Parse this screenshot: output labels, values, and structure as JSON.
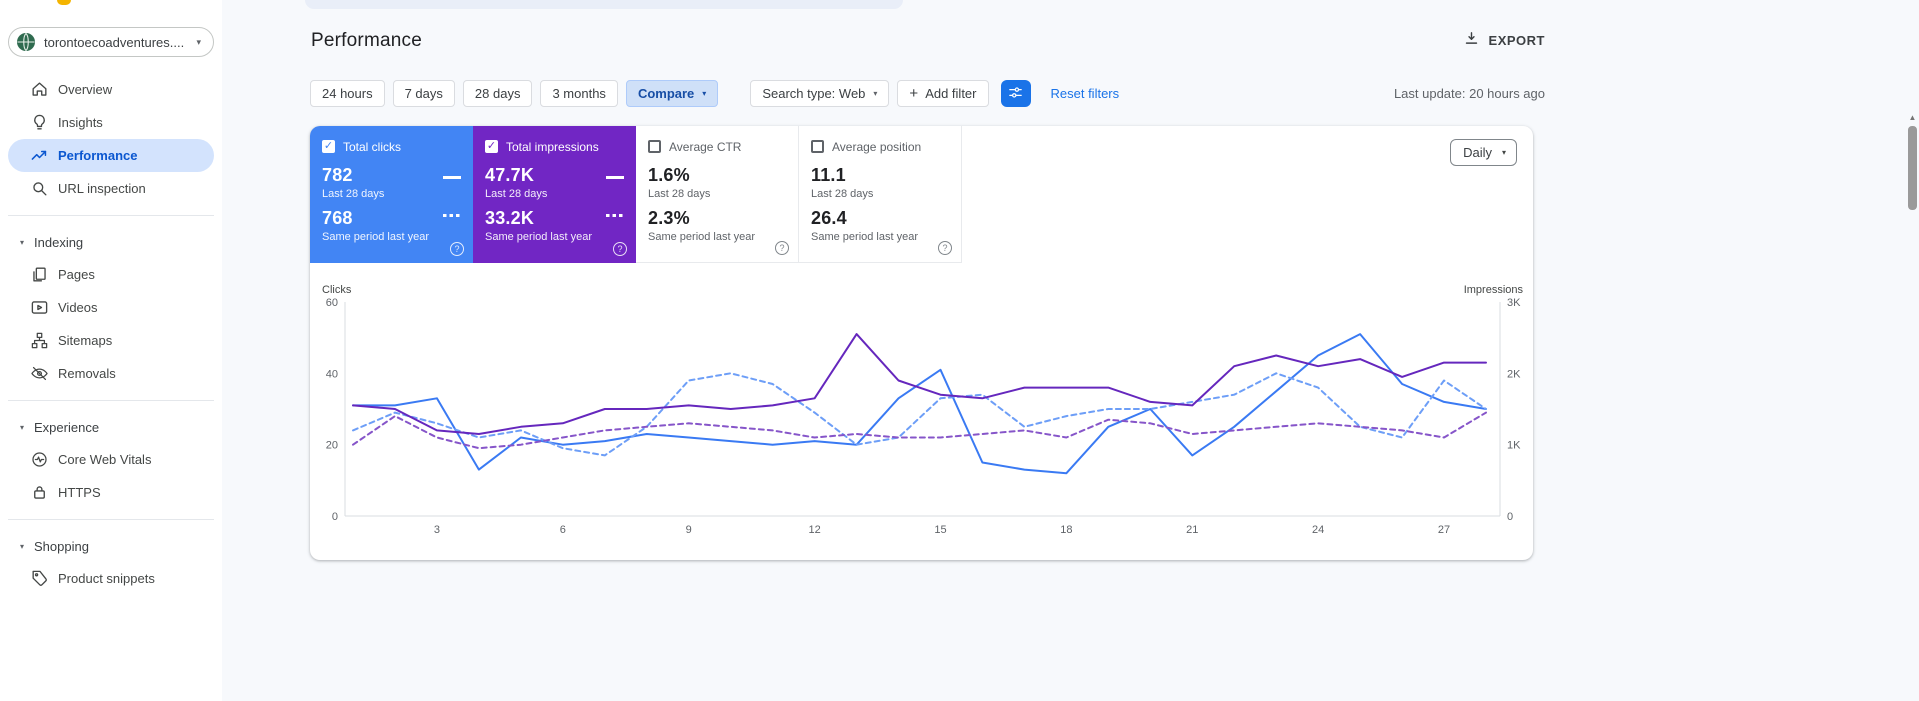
{
  "icons": {
    "check": "✓",
    "dropdown_caret": "▾",
    "section_caret": "▾",
    "help": "?",
    "plus": "+",
    "scroll_up": "▲"
  },
  "sidebar": {
    "property_selector": {
      "label": "torontoecoadventures...."
    },
    "primary_items": [
      {
        "label": "Overview",
        "icon": "home-icon"
      },
      {
        "label": "Insights",
        "icon": "lightbulb-icon"
      },
      {
        "label": "Performance",
        "icon": "performance-icon",
        "selected": true
      },
      {
        "label": "URL inspection",
        "icon": "search-icon"
      }
    ],
    "sections": [
      {
        "label": "Indexing",
        "items": [
          {
            "label": "Pages",
            "icon": "pages-icon"
          },
          {
            "label": "Videos",
            "icon": "video-icon"
          },
          {
            "label": "Sitemaps",
            "icon": "sitemap-icon"
          },
          {
            "label": "Removals",
            "icon": "removals-icon"
          }
        ]
      },
      {
        "label": "Experience",
        "items": [
          {
            "label": "Core Web Vitals",
            "icon": "core-web-vitals-icon"
          },
          {
            "label": "HTTPS",
            "icon": "lock-icon"
          }
        ]
      },
      {
        "label": "Shopping",
        "items": [
          {
            "label": "Product snippets",
            "icon": "tag-icon"
          }
        ]
      }
    ]
  },
  "header": {
    "title": "Performance",
    "export_label": "EXPORT"
  },
  "filter_bar": {
    "date_ranges": [
      {
        "label": "24 hours"
      },
      {
        "label": "7 days"
      },
      {
        "label": "28 days"
      },
      {
        "label": "3 months"
      }
    ],
    "compare": {
      "label": "Compare",
      "active": true
    },
    "search_type": {
      "label": "Search type: Web"
    },
    "add_filter": {
      "label": "Add filter"
    },
    "reset_filters": {
      "label": "Reset filters"
    },
    "last_update": "Last update: 20 hours ago"
  },
  "metrics": {
    "granularity": {
      "label": "Daily"
    },
    "cards": [
      {
        "label": "Total clicks",
        "checked": true,
        "value": "782",
        "value_period": "Last 28 days",
        "compare_value": "768",
        "compare_period": "Same period last year",
        "color": "#4285f4"
      },
      {
        "label": "Total impressions",
        "checked": true,
        "value": "47.7K",
        "value_period": "Last 28 days",
        "compare_value": "33.2K",
        "compare_period": "Same period last year",
        "color": "#7126c4"
      },
      {
        "label": "Average CTR",
        "checked": false,
        "value": "1.6%",
        "value_period": "Last 28 days",
        "compare_value": "2.3%",
        "compare_period": "Same period last year"
      },
      {
        "label": "Average position",
        "checked": false,
        "value": "11.1",
        "value_period": "Last 28 days",
        "compare_value": "26.4",
        "compare_period": "Same period last year"
      }
    ]
  },
  "chart_data": {
    "type": "line",
    "days": [
      1,
      2,
      3,
      4,
      5,
      6,
      7,
      8,
      9,
      10,
      11,
      12,
      13,
      14,
      15,
      16,
      17,
      18,
      19,
      20,
      21,
      22,
      23,
      24,
      25,
      26,
      27,
      28
    ],
    "x_tick_days": [
      3,
      6,
      9,
      12,
      15,
      18,
      21,
      24,
      27
    ],
    "left_axis": {
      "title": "Clicks",
      "range": [
        0,
        60
      ],
      "ticks": [
        0,
        20,
        40,
        60
      ]
    },
    "right_axis": {
      "title": "Impressions",
      "range": [
        0,
        3000
      ],
      "ticks": [
        "0",
        "1K",
        "2K",
        "3K"
      ],
      "tick_values": [
        0,
        1000,
        2000,
        3000
      ]
    },
    "grid": false,
    "legend_position": "none",
    "series": [
      {
        "id": "clicks-current",
        "name": "Total clicks (last 28 days)",
        "axis": "left",
        "style": "solid",
        "color": "#3a7af3",
        "values": [
          31,
          31,
          33,
          13,
          22,
          20,
          21,
          23,
          22,
          21,
          20,
          21,
          20,
          33,
          41,
          15,
          13,
          12,
          25,
          30,
          17,
          25,
          35,
          45,
          51,
          37,
          32,
          30
        ]
      },
      {
        "id": "clicks-previous",
        "name": "Total clicks (same period last year)",
        "axis": "left",
        "style": "dashed",
        "color": "#6d9ef7",
        "values": [
          24,
          29,
          26,
          22,
          24,
          19,
          17,
          25,
          38,
          40,
          37,
          29,
          20,
          22,
          33,
          34,
          25,
          28,
          30,
          30,
          32,
          34,
          40,
          36,
          25,
          22,
          38,
          30
        ]
      },
      {
        "id": "impressions-current",
        "name": "Total impressions (last 28 days)",
        "axis": "right",
        "style": "solid",
        "color": "#6527bd",
        "values": [
          1550,
          1500,
          1200,
          1150,
          1250,
          1300,
          1500,
          1500,
          1550,
          1500,
          1550,
          1650,
          2550,
          1900,
          1700,
          1650,
          1800,
          1800,
          1800,
          1600,
          1550,
          2100,
          2250,
          2100,
          2200,
          1950,
          2150,
          2150
        ]
      },
      {
        "id": "impressions-previous",
        "name": "Total impressions (same period last year)",
        "axis": "right",
        "style": "dashed",
        "color": "#8655c9",
        "values": [
          1000,
          1400,
          1100,
          950,
          1000,
          1100,
          1200,
          1250,
          1300,
          1250,
          1200,
          1100,
          1150,
          1100,
          1100,
          1150,
          1200,
          1100,
          1350,
          1300,
          1150,
          1200,
          1250,
          1300,
          1250,
          1200,
          1100,
          1450
        ]
      }
    ]
  }
}
